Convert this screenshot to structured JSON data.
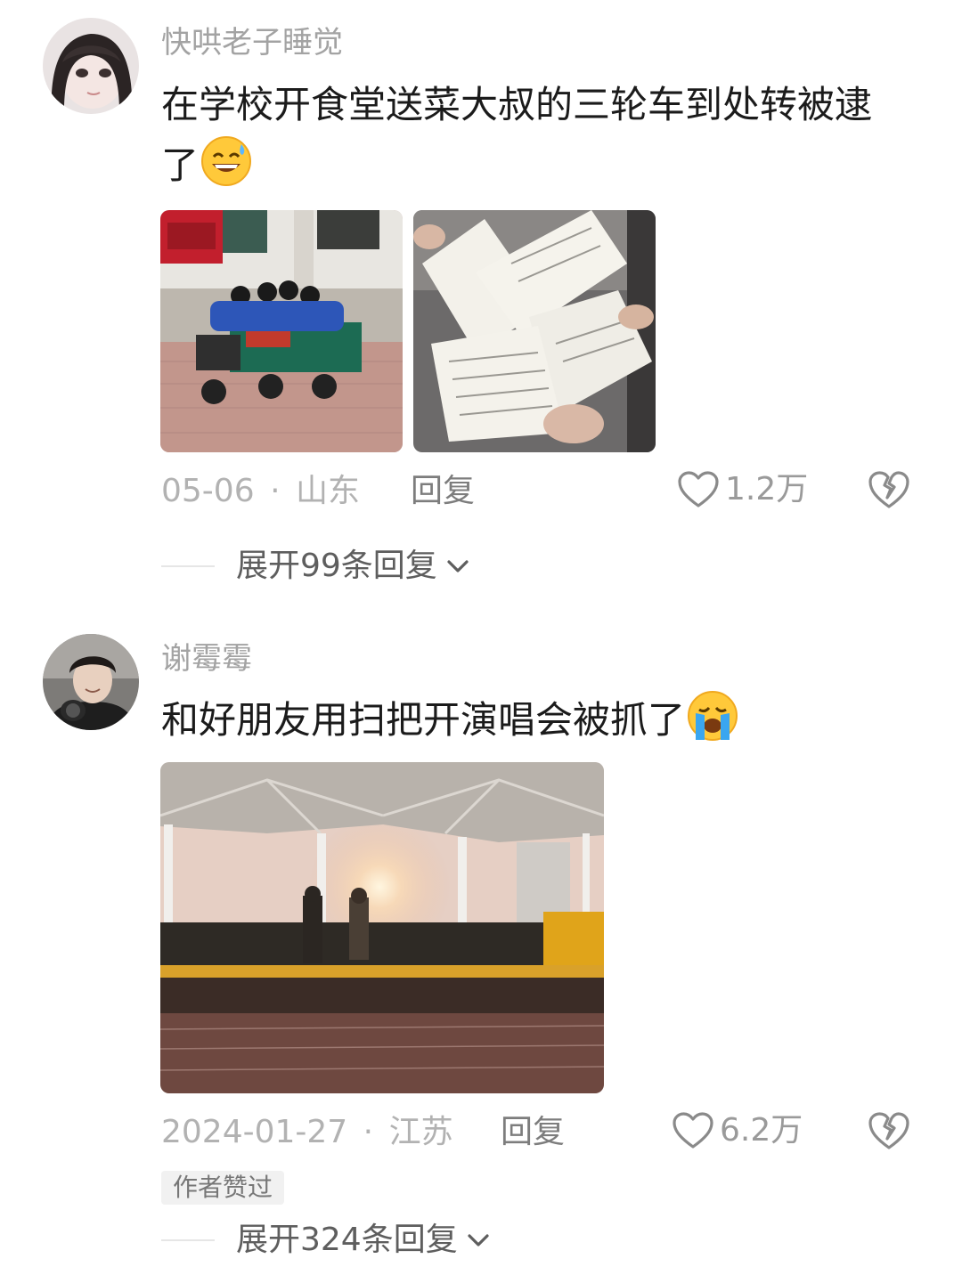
{
  "comments": [
    {
      "username": "快哄老子睡觉",
      "text": "在学校开食堂送菜大叔的三轮车到处转被逮了",
      "emoji": "grinning-sweat-emoji",
      "date": "05-06",
      "separator": "·",
      "location": "山东",
      "reply_label": "回复",
      "likes": "1.2万",
      "expand_label": "展开99条回复"
    },
    {
      "username": "谢霉霉",
      "text": "和好朋友用扫把开演唱会被抓了",
      "emoji": "crying-emoji",
      "date": "2024-01-27",
      "separator": "·",
      "location": "江苏",
      "reply_label": "回复",
      "likes": "6.2万",
      "author_badge": "作者赞过",
      "expand_label": "展开324条回复"
    }
  ],
  "colors": {
    "username": "#a3a3a3",
    "meta": "#b2b2b2",
    "text": "#1b1b1b"
  }
}
